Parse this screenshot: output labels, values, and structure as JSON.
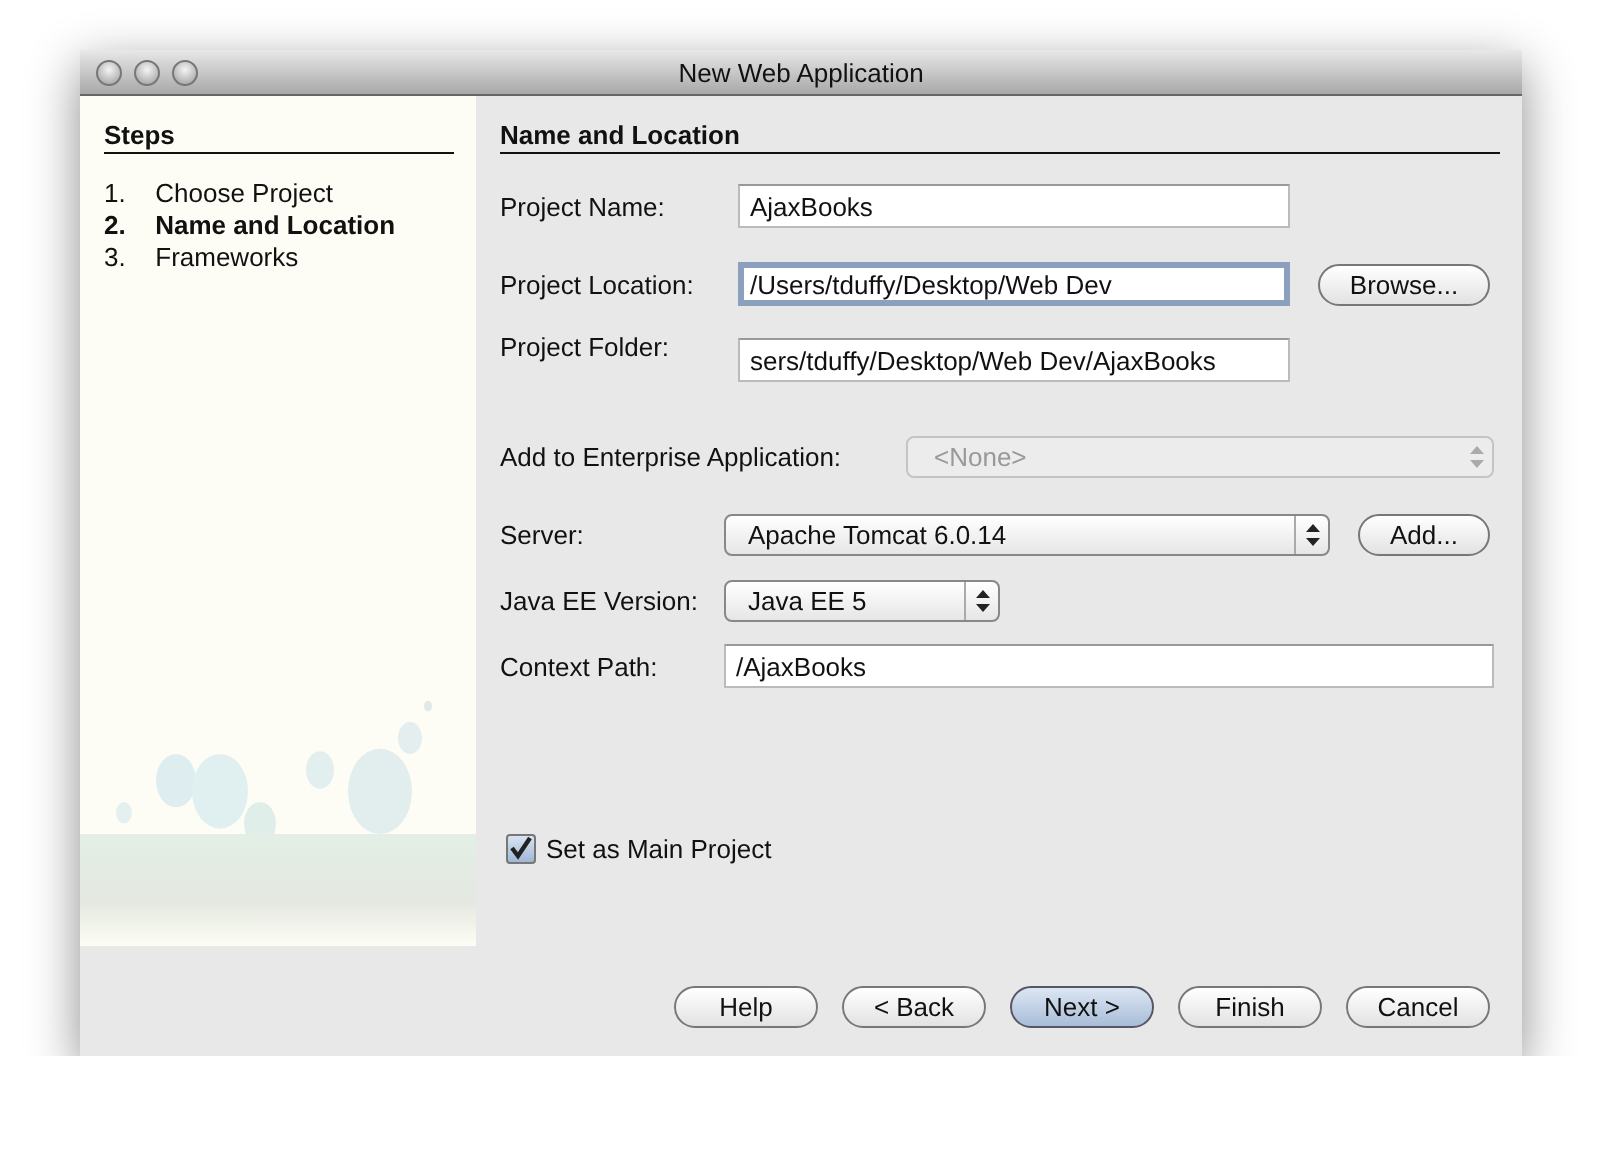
{
  "window": {
    "title": "New Web Application"
  },
  "steps_panel": {
    "title": "Steps",
    "steps": [
      {
        "number": "1.",
        "label": "Choose Project",
        "selected": false
      },
      {
        "number": "2.",
        "label": "Name and Location",
        "selected": true
      },
      {
        "number": "3.",
        "label": "Frameworks",
        "selected": false
      }
    ]
  },
  "panel": {
    "title": "Name and Location"
  },
  "fields": [
    {
      "kind": "text",
      "label": "Project Name:",
      "value": "AjaxBooks",
      "focused": false
    },
    {
      "kind": "text",
      "label": "Project Location:",
      "value": "/Users/tduffy/Desktop/Web Dev",
      "focused": true,
      "button": "Browse..."
    },
    {
      "kind": "text",
      "label": "Project Folder:",
      "value": "sers/tduffy/Desktop/Web Dev/AjaxBooks",
      "focused": false
    },
    {
      "kind": "select",
      "label": "Add to Enterprise Application:",
      "value": "<None>",
      "disabled": true
    },
    {
      "kind": "select",
      "label": "Server:",
      "value": "Apache Tomcat 6.0.14",
      "disabled": false,
      "button": "Add..."
    },
    {
      "kind": "select",
      "label": "Java EE Version:",
      "value": "Java EE 5",
      "disabled": false
    },
    {
      "kind": "text",
      "label": "Context Path:",
      "value": "/AjaxBooks",
      "focused": false
    }
  ],
  "main_project": {
    "label": "Set as Main Project",
    "checked": true
  },
  "buttons": [
    {
      "label": "Help",
      "default": false
    },
    {
      "label": "< Back",
      "default": false
    },
    {
      "label": "Next >",
      "default": true
    },
    {
      "label": "Finish",
      "default": false
    },
    {
      "label": "Cancel",
      "default": false
    }
  ]
}
